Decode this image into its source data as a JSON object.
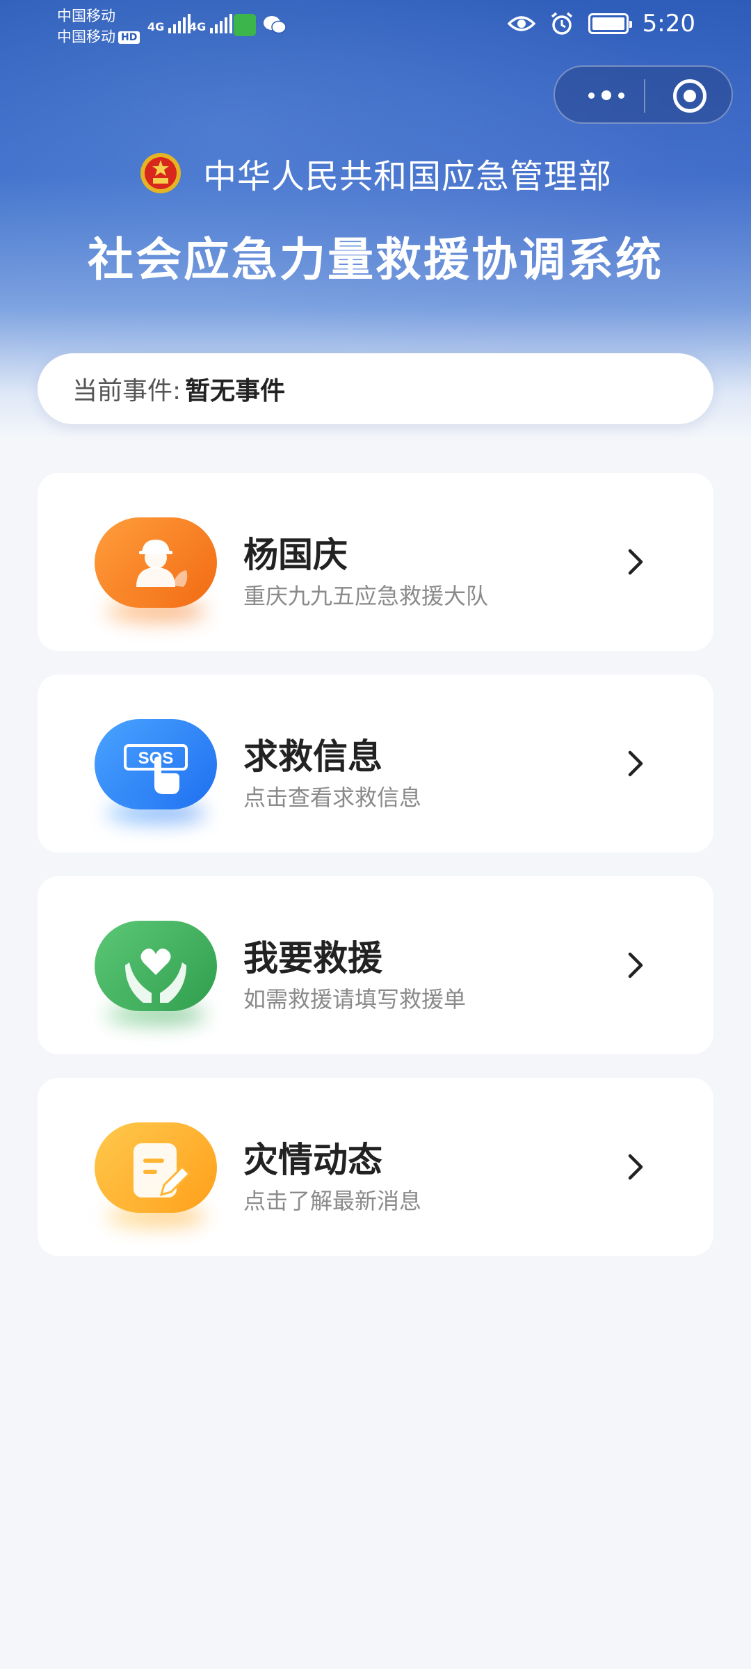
{
  "status_bar": {
    "carrier_1": "中国移动",
    "carrier_2": "中国移动",
    "hd_badge": "HD",
    "network_1": "4G",
    "network_2": "4G",
    "time": "5:20"
  },
  "header": {
    "ministry_name": "中华人民共和国应急管理部",
    "system_title": "社会应急力量救援协调系统"
  },
  "event": {
    "label": "当前事件:",
    "value": "暂无事件"
  },
  "cards": [
    {
      "title": "杨国庆",
      "subtitle": "重庆九九五应急救援大队",
      "icon": "rescuer-icon",
      "color": "#f5761c"
    },
    {
      "title": "求救信息",
      "subtitle": "点击查看求救信息",
      "icon": "sos-icon",
      "color": "#2f82f5"
    },
    {
      "title": "我要救援",
      "subtitle": "如需救援请填写救援单",
      "icon": "heart-hands-icon",
      "color": "#3bb15c"
    },
    {
      "title": "灾情动态",
      "subtitle": "点击了解最新消息",
      "icon": "document-edit-icon",
      "color": "#ffae25"
    }
  ]
}
